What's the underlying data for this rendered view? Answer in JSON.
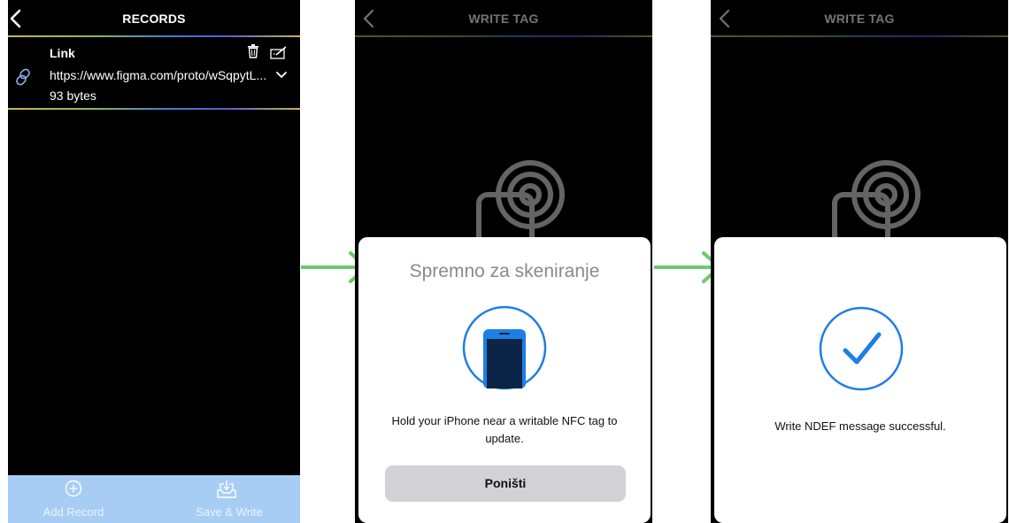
{
  "colors": {
    "arrow": "#6cc96c",
    "bottom_bar": "#a8cdf5",
    "ios_blue": "#1e7ee4",
    "cancel_bg": "#d1d1d6"
  },
  "screen1": {
    "title": "RECORDS",
    "record": {
      "type": "Link",
      "url": "https://www.figma.com/proto/wSqpytL...",
      "size": "93 bytes",
      "icons": [
        "link-icon",
        "trash-icon",
        "edit-icon",
        "chevron-down-icon"
      ]
    },
    "bottom_bar": {
      "add_label": "Add Record",
      "save_label": "Save & Write"
    }
  },
  "screen2": {
    "title": "WRITE TAG",
    "sheet": {
      "title": "Spremno za skeniranje",
      "message": "Hold your iPhone near a writable NFC tag to update.",
      "cancel_label": "Poništi"
    }
  },
  "screen3": {
    "title": "WRITE TAG",
    "sheet": {
      "message": "Write NDEF message successful."
    }
  }
}
